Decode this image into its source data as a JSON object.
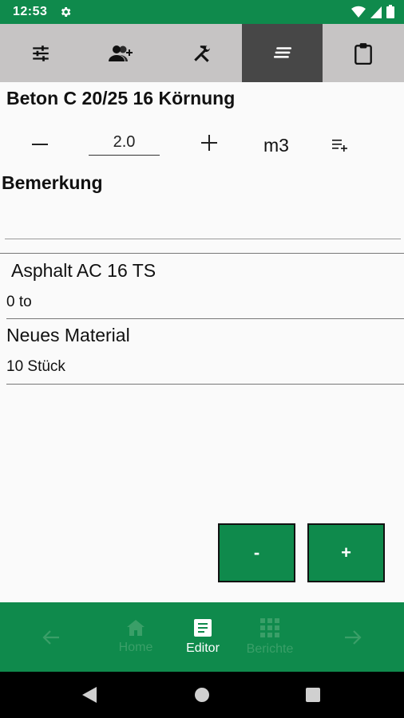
{
  "status_bar": {
    "time": "12:53"
  },
  "tabs": [
    {
      "icon": "sliders-icon",
      "active": false
    },
    {
      "icon": "person-add-icon",
      "active": false
    },
    {
      "icon": "tools-icon",
      "active": false
    },
    {
      "icon": "notes-icon",
      "active": true
    },
    {
      "icon": "clipboard-icon",
      "active": false
    }
  ],
  "item": {
    "title": "Beton C 20/25 16 Körnung",
    "quantity": "2.0",
    "unit": "m3"
  },
  "remark": {
    "label": "Bemerkung",
    "value": ""
  },
  "materials": [
    {
      "name": "Asphalt AC 16 TS",
      "amount": "0 to"
    },
    {
      "name": "Neues Material",
      "amount": "10 Stück"
    }
  ],
  "actions": {
    "minus_label": "-",
    "plus_label": "+"
  },
  "bottom_nav": {
    "home_label": "Home",
    "editor_label": "Editor",
    "reports_label": "Berichte"
  },
  "colors": {
    "primary": "#0f8a4c",
    "tab_bg": "#c6c4c4",
    "tab_active": "#474747"
  }
}
